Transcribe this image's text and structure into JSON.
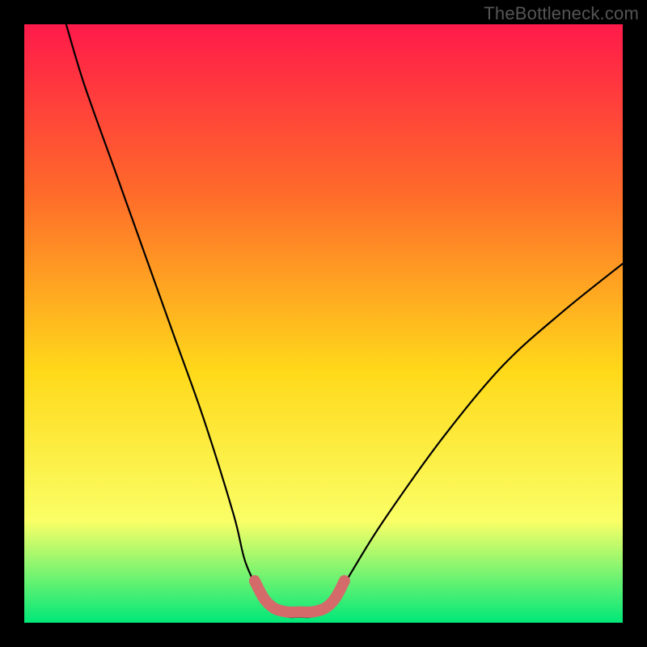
{
  "watermark": "TheBottleneck.com",
  "chart_data": {
    "type": "line",
    "title": "",
    "xlabel": "",
    "ylabel": "",
    "xlim": [
      0,
      100
    ],
    "ylim": [
      0,
      100
    ],
    "grid": false,
    "legend": false,
    "series": [
      {
        "name": "bottleneck-curve",
        "x": [
          7,
          10,
          15,
          20,
          25,
          30,
          35,
          37,
          40,
          42,
          44,
          46,
          48,
          50,
          52,
          55,
          60,
          70,
          80,
          90,
          100
        ],
        "values": [
          100,
          90,
          76,
          62,
          48,
          34,
          18,
          10,
          4,
          2,
          1,
          1,
          1,
          2,
          4,
          9,
          17,
          31,
          43,
          52,
          60
        ],
        "color": "#000000"
      },
      {
        "name": "optimal-zone-marker",
        "x": [
          38.5,
          39.5,
          40.5,
          42,
          44,
          46,
          48,
          50,
          51.5,
          52.5,
          53.5
        ],
        "values": [
          7,
          5,
          3.5,
          2.3,
          1.8,
          1.8,
          1.8,
          2.3,
          3.5,
          5,
          7
        ],
        "color": "#d46a6a"
      }
    ],
    "background_gradient": {
      "top": "#ff1a4a",
      "upper": "#ff6a2a",
      "mid": "#ffd91a",
      "lower": "#faff66",
      "bottom": "#00e879"
    }
  }
}
